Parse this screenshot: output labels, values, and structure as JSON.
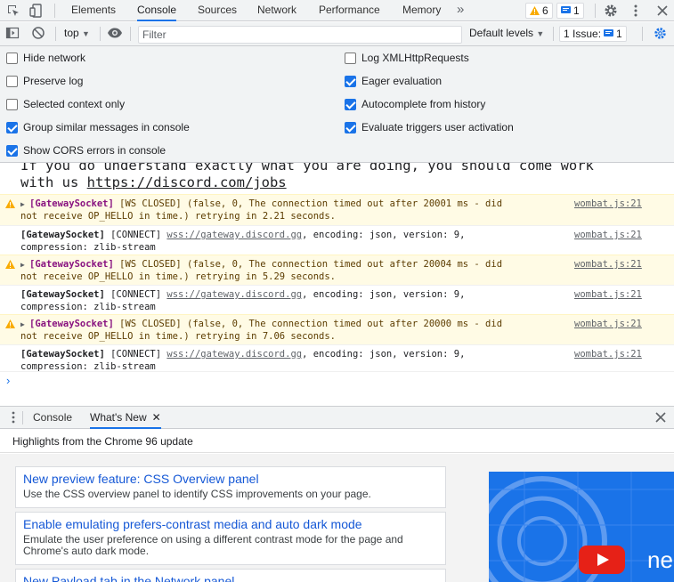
{
  "tabs": [
    "Elements",
    "Console",
    "Sources",
    "Network",
    "Performance",
    "Memory"
  ],
  "warnings_count": "6",
  "messages_count": "1",
  "toolbar": {
    "context": "top",
    "filter_placeholder": "Filter",
    "levels": "Default levels",
    "issues_label": "1 Issue:",
    "issues_count": "1"
  },
  "settings": {
    "left": [
      {
        "label": "Hide network",
        "checked": false
      },
      {
        "label": "Preserve log",
        "checked": false
      },
      {
        "label": "Selected context only",
        "checked": false
      },
      {
        "label": "Group similar messages in console",
        "checked": true
      },
      {
        "label": "Show CORS errors in console",
        "checked": true
      }
    ],
    "right": [
      {
        "label": "Log XMLHttpRequests",
        "checked": false
      },
      {
        "label": "Eager evaluation",
        "checked": true
      },
      {
        "label": "Autocomplete from history",
        "checked": true
      },
      {
        "label": "Evaluate triggers user activation",
        "checked": true
      }
    ]
  },
  "console": {
    "intro_line1": "If you do understand exactly what you are doing, you should come work",
    "intro_line2_prefix": "with us ",
    "intro_link": "https://discord.com/jobs",
    "messages": [
      {
        "type": "warn",
        "tag": "[GatewaySocket]",
        "line1": " [WS CLOSED] (false, 0, The connection timed out after 20001 ms - did",
        "line2": "not receive OP_HELLO in time.) retrying in 2.21 seconds.",
        "source": "wombat.js:21"
      },
      {
        "type": "log",
        "tag": "[GatewaySocket]",
        "pre": " [CONNECT] ",
        "url": "wss://gateway.discord.gg",
        "post": ", encoding: json, version: 9,",
        "line2": "compression: zlib-stream",
        "source": "wombat.js:21"
      },
      {
        "type": "warn",
        "tag": "[GatewaySocket]",
        "line1": " [WS CLOSED] (false, 0, The connection timed out after 20004 ms - did",
        "line2": "not receive OP_HELLO in time.) retrying in 5.29 seconds.",
        "source": "wombat.js:21"
      },
      {
        "type": "log",
        "tag": "[GatewaySocket]",
        "pre": " [CONNECT] ",
        "url": "wss://gateway.discord.gg",
        "post": ", encoding: json, version: 9,",
        "line2": "compression: zlib-stream",
        "source": "wombat.js:21"
      },
      {
        "type": "warn",
        "tag": "[GatewaySocket]",
        "line1": " [WS CLOSED] (false, 0, The connection timed out after 20000 ms - did",
        "line2": "not receive OP_HELLO in time.) retrying in 7.06 seconds.",
        "source": "wombat.js:21"
      },
      {
        "type": "log",
        "tag": "[GatewaySocket]",
        "pre": " [CONNECT] ",
        "url": "wss://gateway.discord.gg",
        "post": ", encoding: json, version: 9,",
        "line2": "compression: zlib-stream",
        "source": "wombat.js:21"
      }
    ]
  },
  "drawer": {
    "tabs": [
      "Console",
      "What's New"
    ],
    "highlights": "Highlights from the Chrome 96 update",
    "cards": [
      {
        "title": "New preview feature: CSS Overview panel",
        "desc": "Use the CSS overview panel to identify CSS improvements on your page."
      },
      {
        "title": "Enable emulating prefers-contrast media and auto dark mode",
        "desc": "Emulate the user preference on using a different contrast mode for the page and Chrome's auto dark mode."
      },
      {
        "title": "New Payload tab in the Network panel",
        "desc": ""
      }
    ],
    "video_text": "ne"
  },
  "colors": {
    "accent": "#1a73e8",
    "warn_bg": "#fffbe5",
    "tag": "#881280"
  }
}
